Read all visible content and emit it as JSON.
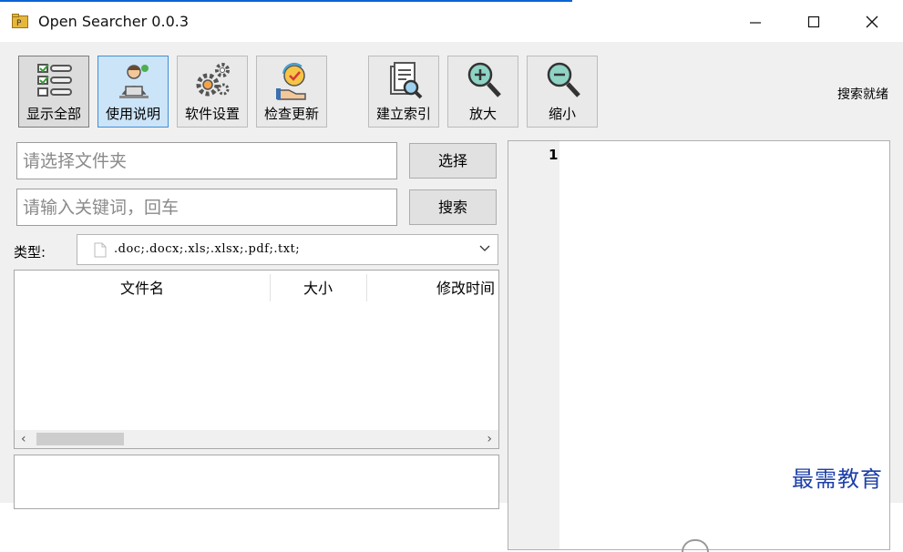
{
  "window": {
    "title": "Open Searcher 0.0.3",
    "accent_color": "#0a64d6",
    "controls": {
      "minimize_icon": "minimize-icon",
      "maximize_icon": "maximize-icon",
      "close_icon": "close-icon"
    }
  },
  "toolbar": {
    "buttons": [
      {
        "label": "显示全部",
        "icon": "checklist-icon",
        "state": "pressed"
      },
      {
        "label": "使用说明",
        "icon": "user-guide-icon",
        "state": "highlighted"
      },
      {
        "label": "软件设置",
        "icon": "gears-icon",
        "state": "normal"
      },
      {
        "label": "检查更新",
        "icon": "update-check-icon",
        "state": "normal"
      },
      {
        "label": "建立索引",
        "icon": "build-index-icon",
        "state": "normal"
      },
      {
        "label": "放大",
        "icon": "zoom-in-icon",
        "state": "normal"
      },
      {
        "label": "缩小",
        "icon": "zoom-out-icon",
        "state": "normal"
      }
    ],
    "status": "搜索就绪"
  },
  "folder": {
    "placeholder": "请选择文件夹",
    "value": "",
    "button_label": "选择"
  },
  "search": {
    "placeholder": "请输入关键词，回车",
    "value": "",
    "button_label": "搜索"
  },
  "filter": {
    "label": "类型:",
    "selected": ".doc;.docx;.xls;.xlsx;.pdf;.txt;",
    "file_icon": "file-icon"
  },
  "results": {
    "columns": [
      "文件名",
      "大小",
      "修改时间"
    ],
    "rows": []
  },
  "preview": {
    "line_numbers": [
      "1"
    ],
    "content": ""
  },
  "watermark": {
    "text": "最需教育"
  }
}
